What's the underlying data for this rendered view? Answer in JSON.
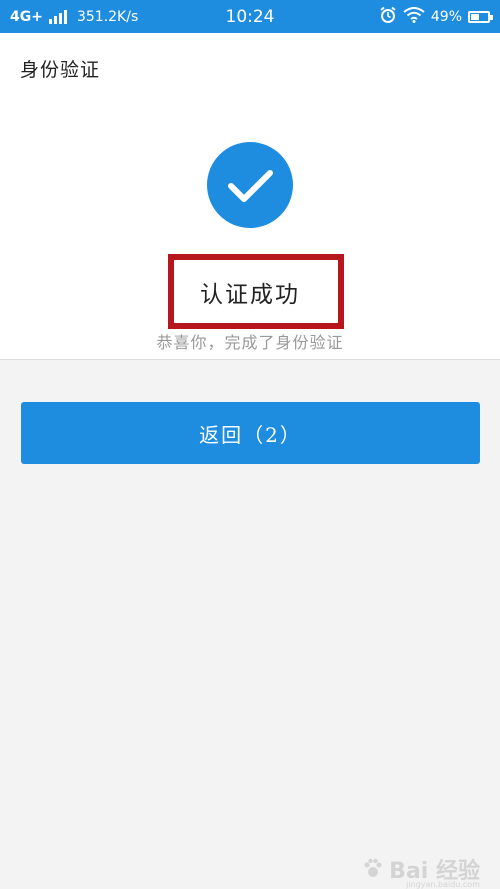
{
  "status_bar": {
    "network": "4G+",
    "speed": "351.2K/s",
    "time": "10:24",
    "battery": "49%",
    "icons": [
      "signal-icon",
      "alarm-icon",
      "wifi-icon",
      "battery-icon"
    ]
  },
  "header": {
    "title": "身份验证"
  },
  "result": {
    "icon": "check-icon",
    "title": "认证成功",
    "subtitle": "恭喜你，完成了身份验证"
  },
  "actions": {
    "return_label": "返回（2）"
  },
  "colors": {
    "primary": "#1e8de0",
    "highlight": "#b7161d",
    "background": "#f3f3f3"
  },
  "watermark": {
    "text": "Bai 经验",
    "sub": "jingyan.baidu.com"
  }
}
